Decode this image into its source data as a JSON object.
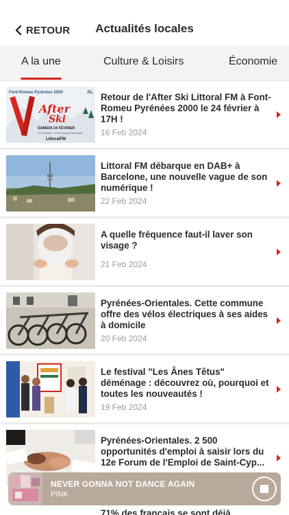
{
  "header": {
    "back_label": "RETOUR",
    "title": "Actualités locales"
  },
  "tabs": [
    {
      "label": "A la une",
      "active": true
    },
    {
      "label": "Culture & Loisirs",
      "active": false
    },
    {
      "label": "Économie",
      "active": false
    }
  ],
  "articles": [
    {
      "title": "Retour de l'After Ski Littoral FM à Font-Romeu Pyrénées 2000 le 24 février à 17H !",
      "date": "16 Feb 2024",
      "image": "after-ski-poster"
    },
    {
      "title": "Littoral FM débarque en DAB+ à Barcelone, une nouvelle vague de son numérique !",
      "date": "22 Feb 2024",
      "image": "barcelona-tower"
    },
    {
      "title": "A quelle fréquence faut-il laver son visage ?",
      "date": "21 Feb 2024",
      "image": "face-washing"
    },
    {
      "title": "Pyrénées-Orientales. Cette commune offre des vélos électriques à ses aides à domicile",
      "date": "20 Feb 2024",
      "image": "electric-bikes"
    },
    {
      "title": "Le festival \"Les Ânes Têtus\" déménage : découvrez où, pourquoi et toutes les nouveautés !",
      "date": "19 Feb 2024",
      "image": "festival-people"
    },
    {
      "title": "Pyrénées-Orientales. 2 500 opportunités d'emploi à saisir lors du 12e Forum de l'Emploi de Saint-Cyp...",
      "date": "",
      "image": "handshake-desk"
    }
  ],
  "next_article_peek": "71% des français se sont déjà",
  "poster": {
    "top": "Font-Romeu Pyrénées 2000",
    "headline_1": "After",
    "headline_2": "Ski",
    "date": "SAMEDI 24 FÉVRIER",
    "sub": "17h l'Ambiant - DJ et le groupe Mass Beat",
    "brand": "LittoralFM",
    "corner": "AL"
  },
  "player": {
    "track": "NEVER GONNA NOT DANCE AGAIN",
    "artist": "PINK",
    "stop_icon": "stop-icon"
  },
  "colors": {
    "accent": "#d6261f",
    "player_bg": "#b9a99a",
    "date_grey": "#9a9a9a"
  }
}
